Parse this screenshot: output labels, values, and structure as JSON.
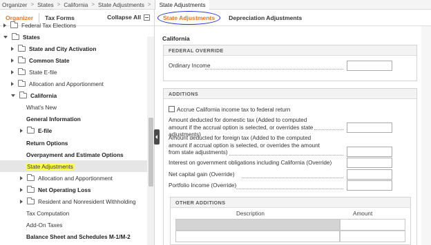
{
  "breadcrumbs": [
    "Organizer",
    "States",
    "California",
    "State Adjustments",
    "State Adjustments"
  ],
  "left": {
    "tabs": [
      "Organizer",
      "Tax Forms"
    ],
    "collapse_label": "Collapse All",
    "tree": [
      {
        "label": "Federal Tax Elections",
        "arrow": "right",
        "folder": true,
        "bold": false,
        "level": 0
      },
      {
        "label": "States",
        "arrow": "down",
        "folder": true,
        "bold": true,
        "level": 0
      },
      {
        "label": "State and City Activation",
        "arrow": "right",
        "folder": true,
        "bold": true,
        "level": 1
      },
      {
        "label": "Common State",
        "arrow": "right",
        "folder": true,
        "bold": true,
        "level": 1
      },
      {
        "label": "State E-file",
        "arrow": "right",
        "folder": true,
        "bold": false,
        "level": 1
      },
      {
        "label": "Allocation and Apportionment",
        "arrow": "right",
        "folder": true,
        "bold": false,
        "level": 1
      },
      {
        "label": "California",
        "arrow": "down",
        "folder": true,
        "bold": true,
        "level": 1
      },
      {
        "label": "What's New",
        "arrow": "",
        "folder": false,
        "bold": false,
        "level": 2
      },
      {
        "label": "General Information",
        "arrow": "",
        "folder": false,
        "bold": true,
        "level": 2
      },
      {
        "label": "E-file",
        "arrow": "right",
        "folder": true,
        "bold": true,
        "level": 2
      },
      {
        "label": "Return Options",
        "arrow": "",
        "folder": false,
        "bold": true,
        "level": 2
      },
      {
        "label": "Overpayment and Estimate Options",
        "arrow": "",
        "folder": false,
        "bold": true,
        "level": 2
      },
      {
        "label": "State Adjustments",
        "arrow": "",
        "folder": false,
        "bold": false,
        "level": 2,
        "selected": true
      },
      {
        "label": "Allocation and Apportionment",
        "arrow": "right",
        "folder": true,
        "bold": false,
        "level": 2
      },
      {
        "label": "Net Operating Loss",
        "arrow": "right",
        "folder": true,
        "bold": true,
        "level": 2
      },
      {
        "label": "Resident and Nonresident Withholding",
        "arrow": "right",
        "folder": true,
        "bold": false,
        "level": 2
      },
      {
        "label": "Tax Computation",
        "arrow": "",
        "folder": false,
        "bold": false,
        "level": 2
      },
      {
        "label": "Add-On Taxes",
        "arrow": "",
        "folder": false,
        "bold": false,
        "level": 2
      },
      {
        "label": "Balance Sheet and Schedules M-1/M-2",
        "arrow": "",
        "folder": false,
        "bold": true,
        "level": 2
      }
    ]
  },
  "right": {
    "tabs": [
      "State Adjustments",
      "Depreciation Adjustments"
    ],
    "section_title": "California",
    "federal_override": {
      "heading": "FEDERAL OVERRIDE",
      "ordinary_income_label": "Ordinary Income",
      "ordinary_income_value": ""
    },
    "additions": {
      "heading": "ADDITIONS",
      "checkbox_label": "Accrue California income tax to federal return",
      "checkbox_checked": false,
      "domestic_tax_label": "Amount deducted for domestic tax (Added to computed amount if the accrual option is selected, or overrides state adjustments)",
      "foreign_tax_label": "Amount deducted for foreign tax (Added to the computed amount if accrual option is selected, or overrides the amount from state adjustments)",
      "interest_label": "Interest on government obligations including California (Override)",
      "net_capital_gain_label": "Net capital gain (Override)",
      "portfolio_income_label": "Portfolio Income (Override)"
    },
    "other_additions": {
      "heading": "OTHER ADDITIONS",
      "columns": [
        "Description",
        "Amount"
      ]
    }
  },
  "colors": {
    "accent": "#e87722",
    "highlight": "#ffff4f",
    "annotation_ring": "#1a2bd1"
  }
}
